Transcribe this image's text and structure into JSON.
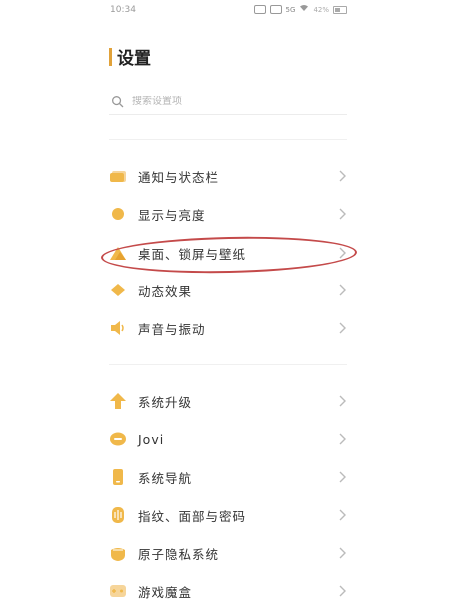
{
  "status_bar": {
    "time": "10:34",
    "icons": [
      "sim-icon",
      "hd-icon",
      "5g-icon",
      "wifi-icon",
      "battery-icon"
    ],
    "battery_text": "42%"
  },
  "header": {
    "title": "设置"
  },
  "search": {
    "placeholder": "搜索设置项"
  },
  "colors": {
    "accent": "#e1a23a",
    "annotation": "#c44a4a",
    "icon": "#f0b84a"
  },
  "groups": [
    {
      "items": [
        {
          "label": "通知与状态栏",
          "icon": "notification-icon"
        },
        {
          "label": "显示与亮度",
          "icon": "brightness-icon"
        },
        {
          "label": "桌面、锁屏与壁纸",
          "icon": "wallpaper-icon",
          "annotated": true
        },
        {
          "label": "动态效果",
          "icon": "motion-icon"
        },
        {
          "label": "声音与振动",
          "icon": "speaker-icon"
        }
      ]
    },
    {
      "items": [
        {
          "label": "系统升级",
          "icon": "upgrade-icon"
        },
        {
          "label": "Jovi",
          "icon": "jovi-icon"
        },
        {
          "label": "系统导航",
          "icon": "phone-icon"
        },
        {
          "label": "指纹、面部与密码",
          "icon": "fingerprint-icon"
        },
        {
          "label": "原子隐私系统",
          "icon": "privacy-icon"
        },
        {
          "label": "游戏魔盒",
          "icon": "gamepad-icon"
        }
      ]
    }
  ]
}
